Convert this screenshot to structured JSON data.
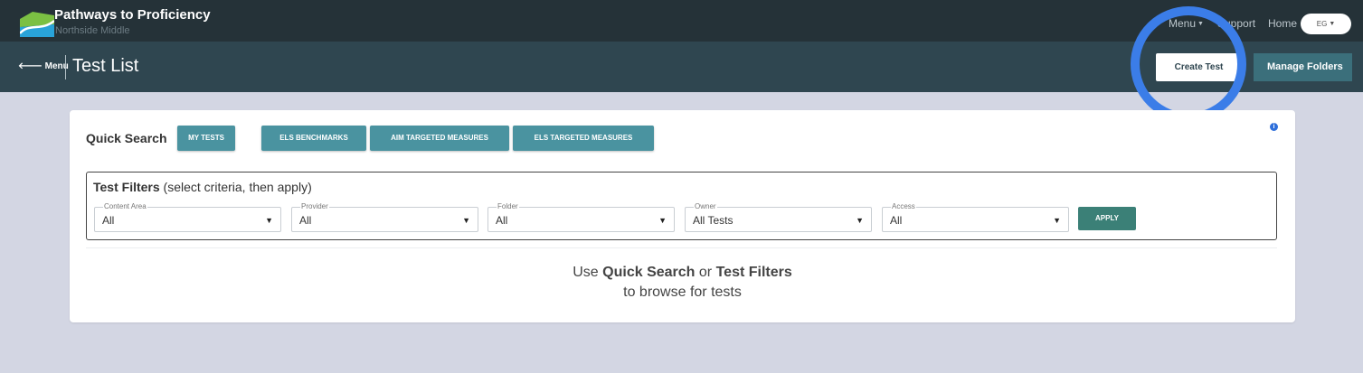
{
  "app": {
    "title": "Pathways to Proficiency",
    "school": "Northside Middle"
  },
  "topnav": {
    "menu": "Menu",
    "support": "Support",
    "home": "Home",
    "user_initials": "EG"
  },
  "subheader": {
    "back_label": "Menu",
    "page_title": "Test List",
    "create_test": "Create Test",
    "manage_folders": "Manage Folders"
  },
  "quick_search": {
    "label": "Quick Search",
    "buttons": [
      "MY TESTS",
      "ELS BENCHMARKS",
      "AIM TARGETED MEASURES",
      "ELS TARGETED MEASURES"
    ]
  },
  "filters": {
    "title_bold": "Test Filters",
    "title_hint": "(select criteria, then apply)",
    "items": [
      {
        "label": "Content Area",
        "value": "All"
      },
      {
        "label": "Provider",
        "value": "All"
      },
      {
        "label": "Folder",
        "value": "All"
      },
      {
        "label": "Owner",
        "value": "All Tests"
      },
      {
        "label": "Access",
        "value": "All"
      }
    ],
    "apply": "APPLY"
  },
  "empty_state": {
    "use": "Use",
    "quick_search": "Quick Search",
    "or": "or",
    "test_filters": "Test Filters",
    "line2": "to browse for tests"
  },
  "icons": {
    "logo": "pathways-logo-icon",
    "back": "arrow-left-icon",
    "caret": "caret-down-icon",
    "info": "info-icon"
  },
  "colors": {
    "topbar": "#253238",
    "subbar": "#2f4650",
    "page_bg": "#d3d6e3",
    "quick_button": "#4a93a0",
    "apply_button": "#3b8077",
    "manage_button": "#3b6f7b",
    "highlight": "#3b7de8"
  }
}
